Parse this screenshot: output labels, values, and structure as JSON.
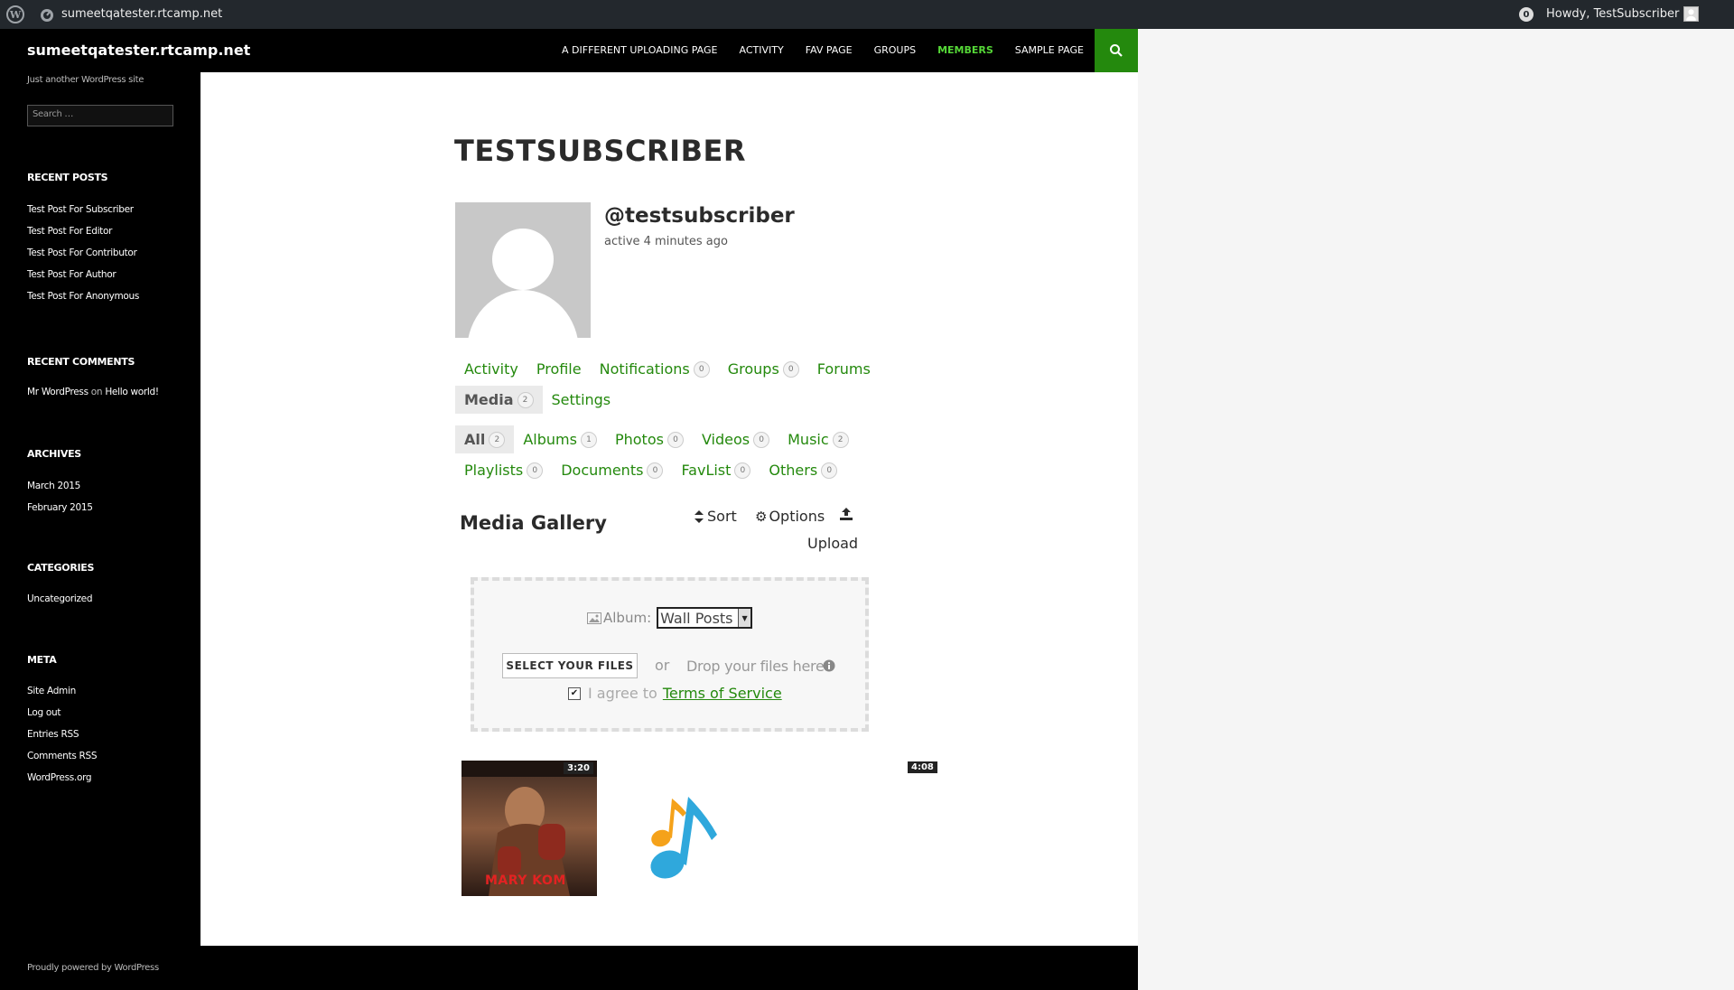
{
  "adminbar": {
    "site_name": "sumeetqatester.rtcamp.net",
    "notifications": "0",
    "howdy": "Howdy, TestSubscriber"
  },
  "masthead": {
    "site_title": "sumeetqatester.rtcamp.net",
    "nav": [
      "A DIFFERENT UPLOADING PAGE",
      "ACTIVITY",
      "FAV PAGE",
      "GROUPS",
      "MEMBERS",
      "SAMPLE PAGE"
    ],
    "current_nav": "MEMBERS"
  },
  "sidebar": {
    "description": "Just another WordPress site",
    "search_placeholder": "Search …",
    "recent_posts_title": "RECENT POSTS",
    "recent_posts": [
      "Test Post For Subscriber",
      "Test Post For Editor",
      "Test Post For Contributor",
      "Test Post For Author",
      "Test Post For Anonymous"
    ],
    "recent_comments_title": "RECENT COMMENTS",
    "recent_comment": {
      "author": "Mr WordPress",
      "on": "on",
      "post": "Hello world!"
    },
    "archives_title": "ARCHIVES",
    "archives": [
      "March 2015",
      "February 2015"
    ],
    "categories_title": "CATEGORIES",
    "categories": [
      "Uncategorized"
    ],
    "meta_title": "META",
    "meta": [
      "Site Admin",
      "Log out",
      "Entries RSS",
      "Comments RSS",
      "WordPress.org"
    ],
    "footer": "Proudly powered by WordPress"
  },
  "profile": {
    "page_title": "TESTSUBSCRIBER",
    "username": "@testsubscriber",
    "active": "active 4 minutes ago"
  },
  "main_tabs_row1": [
    {
      "label": "Activity",
      "count": null
    },
    {
      "label": "Profile",
      "count": null
    },
    {
      "label": "Notifications",
      "count": "0"
    },
    {
      "label": "Groups",
      "count": "0"
    },
    {
      "label": "Forums",
      "count": null
    }
  ],
  "main_tabs_row2": [
    {
      "label": "Media",
      "count": "2",
      "selected": true
    },
    {
      "label": "Settings",
      "count": null
    }
  ],
  "media_tabs_row1": [
    {
      "label": "All",
      "count": "2",
      "selected": true
    },
    {
      "label": "Albums",
      "count": "1"
    },
    {
      "label": "Photos",
      "count": "0"
    },
    {
      "label": "Videos",
      "count": "0"
    },
    {
      "label": "Music",
      "count": "2"
    }
  ],
  "media_tabs_row2": [
    {
      "label": "Playlists",
      "count": "0"
    },
    {
      "label": "Documents",
      "count": "0"
    },
    {
      "label": "FavList",
      "count": "0"
    },
    {
      "label": "Others",
      "count": "0"
    }
  ],
  "gallery": {
    "title": "Media Gallery",
    "sort": "Sort",
    "options": "Options",
    "upload": "Upload"
  },
  "uploader": {
    "album_label": "Album:",
    "album_value": "Wall Posts",
    "select_button": "SELECT YOUR FILES",
    "or": "or",
    "drop_text": "Drop your files here",
    "agree_text": "I agree to",
    "terms_link": "Terms of Service"
  },
  "media_items": [
    {
      "type": "video",
      "duration": "3:20",
      "poster_text": "MARY KOM"
    },
    {
      "type": "music",
      "duration": "4:08"
    }
  ],
  "colors": {
    "accent": "#24890d",
    "current_nav": "#55d737",
    "adminbar": "#23282d"
  }
}
